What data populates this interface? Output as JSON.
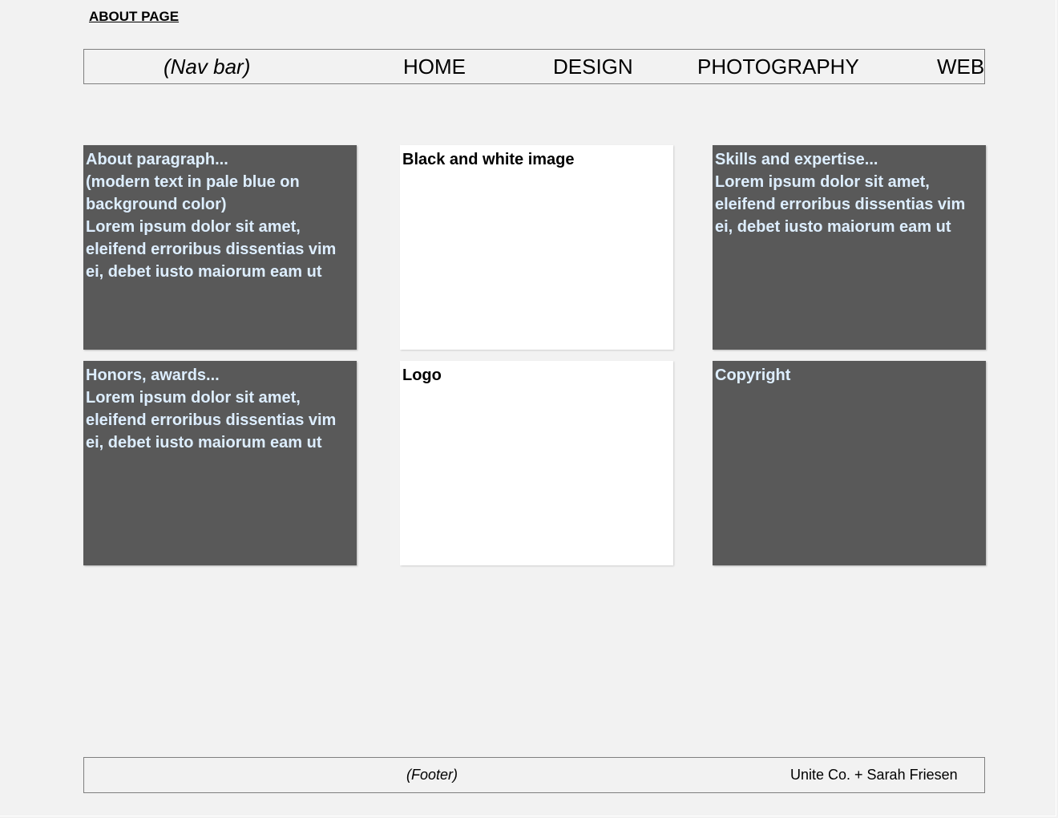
{
  "page": {
    "title": "ABOUT PAGE"
  },
  "navbar": {
    "label": "(Nav bar)",
    "items": [
      "HOME",
      "DESIGN",
      "PHOTOGRAPHY",
      "WEB"
    ]
  },
  "panels": {
    "about": "About paragraph...\n(modern text in pale blue on background color)\nLorem ipsum dolor sit amet, eleifend erroribus dissentias vim ei, debet iusto maiorum eam ut",
    "image": "Black and white image",
    "skills": "Skills and expertise...\nLorem ipsum dolor sit amet, eleifend erroribus dissentias vim ei, debet iusto maiorum eam ut",
    "honors": "Honors, awards...\nLorem ipsum dolor sit amet, eleifend erroribus dissentias vim ei, debet iusto maiorum eam ut",
    "logo": "Logo",
    "copyright": "Copyright"
  },
  "footer": {
    "label": "(Footer)",
    "credit": "Unite Co. + Sarah Friesen"
  },
  "colors": {
    "background": "#f2f2f2",
    "dark_panel": "#595959",
    "pale_blue_text": "#ddeeff",
    "light_panel": "#ffffff",
    "border": "#7f7f7f"
  }
}
